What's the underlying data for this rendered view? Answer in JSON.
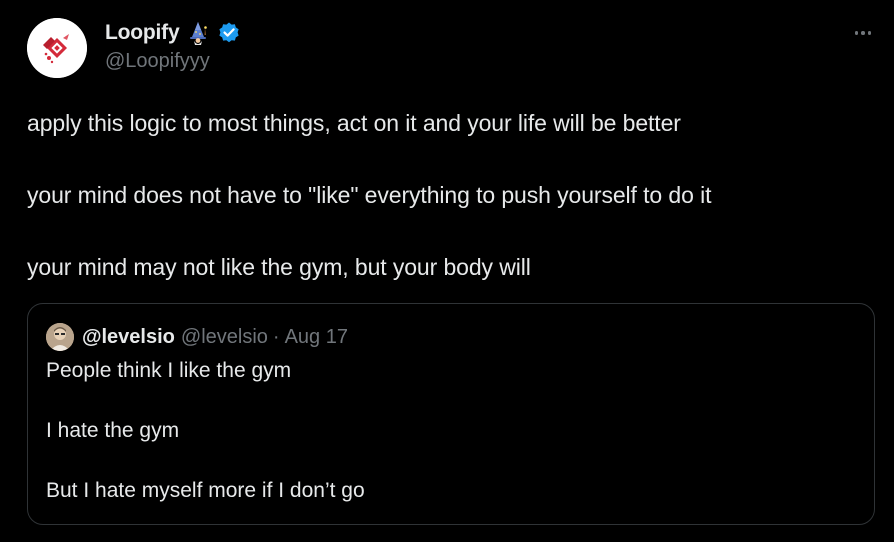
{
  "author": {
    "display_name": "Loopify",
    "emoji_icon": "wizard-emoji",
    "verified_icon": "verified-badge-icon",
    "handle": "@Loopifyyy"
  },
  "tweet": {
    "lines": [
      "apply this logic to most things, act on it and your life will be better",
      "your mind does not have to \"like\" everything to push yourself to do it",
      "your mind may not like the gym, but your body will"
    ]
  },
  "quoted_tweet": {
    "display_name": "@levelsio",
    "handle": "@levelsio",
    "separator": "·",
    "date": "Aug 17",
    "lines": [
      "People think I like the gym",
      "I hate the gym",
      "But I hate myself more if I don’t go"
    ]
  },
  "colors": {
    "background": "#000000",
    "text": "#e7e9ea",
    "secondary_text": "#71767b",
    "border": "#2f3336",
    "verified_blue": "#1d9bf0"
  },
  "more_icon": "more-horizontal-icon"
}
